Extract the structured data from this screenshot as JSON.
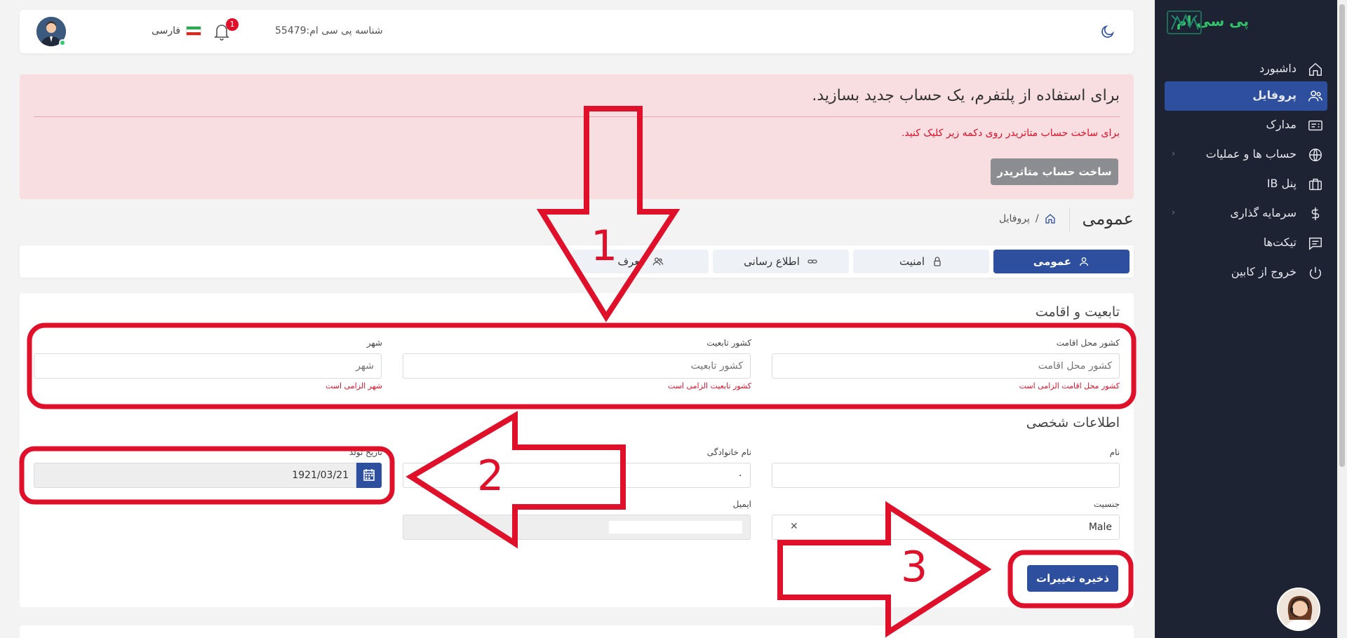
{
  "sidebar": {
    "brand": "پی سی ام",
    "items": [
      {
        "label": "داشبورد",
        "icon": "home-icon"
      },
      {
        "label": "پروفایل",
        "icon": "users-icon",
        "active": true
      },
      {
        "label": "مدارک",
        "icon": "id-card-icon"
      },
      {
        "label": "حساب ها و عملیات",
        "icon": "globe-icon",
        "has_submenu": true
      },
      {
        "label": "پنل IB",
        "icon": "briefcase-icon"
      },
      {
        "label": "سرمایه گذاری",
        "icon": "dollar-icon",
        "has_submenu": true
      },
      {
        "label": "تیکت‌ها",
        "icon": "chat-icon"
      },
      {
        "label": "خروج از کابین",
        "icon": "power-icon"
      }
    ],
    "chevron": "‹"
  },
  "topbar": {
    "user_id": "شناسه پی سی ام:55479",
    "notification_count": "1",
    "language": "فارسی"
  },
  "alert": {
    "title": "برای استفاده از پلتفرم، یک حساب جدید بسازید.",
    "text": "برای ساخت حساب متاتریدر روی دکمه زیر کلیک کنید.",
    "button": "ساخت حساب متاتریدر"
  },
  "page": {
    "title": "عمومی",
    "breadcrumb": "پروفایل",
    "breadcrumb_sep": "/"
  },
  "tabs": [
    {
      "label": "عمومی",
      "icon": "user-icon",
      "active": true
    },
    {
      "label": "امنیت",
      "icon": "lock-icon"
    },
    {
      "label": "اطلاع رسانی",
      "icon": "link-icon"
    },
    {
      "label": "معرف",
      "icon": "users-icon"
    }
  ],
  "form": {
    "residence_title": "تابعیت و اقامت",
    "residence_country": {
      "label": "کشور محل اقامت",
      "placeholder": "کشور محل اقامت",
      "error": "کشور محل اقامت الزامی است"
    },
    "citizenship_country": {
      "label": "کشور تابعیت",
      "placeholder": "کشور تابعیت",
      "error": "کشور تابعیت الزامی است"
    },
    "city": {
      "label": "شهر",
      "placeholder": "شهر",
      "error": "شهر الزامی است"
    },
    "personal_title": "اطلاعات شخصی",
    "first_name": {
      "label": "نام",
      "value": ""
    },
    "last_name": {
      "label": "نام خانوادگی",
      "value": "٠"
    },
    "birth_date": {
      "label": "تاریخ تولد",
      "value": "1921/03/21"
    },
    "gender": {
      "label": "جنسیت",
      "value": "Male"
    },
    "email": {
      "label": "ایمیل",
      "value": ""
    },
    "save_button": "ذخیره تغییرات"
  },
  "annotations": [
    "1",
    "2",
    "3"
  ],
  "colors": {
    "primary": "#2d4f9e",
    "sidebar": "#1d2333",
    "error": "#e0102a",
    "alert_bg": "#f8dde1",
    "brand": "#33c46a"
  }
}
